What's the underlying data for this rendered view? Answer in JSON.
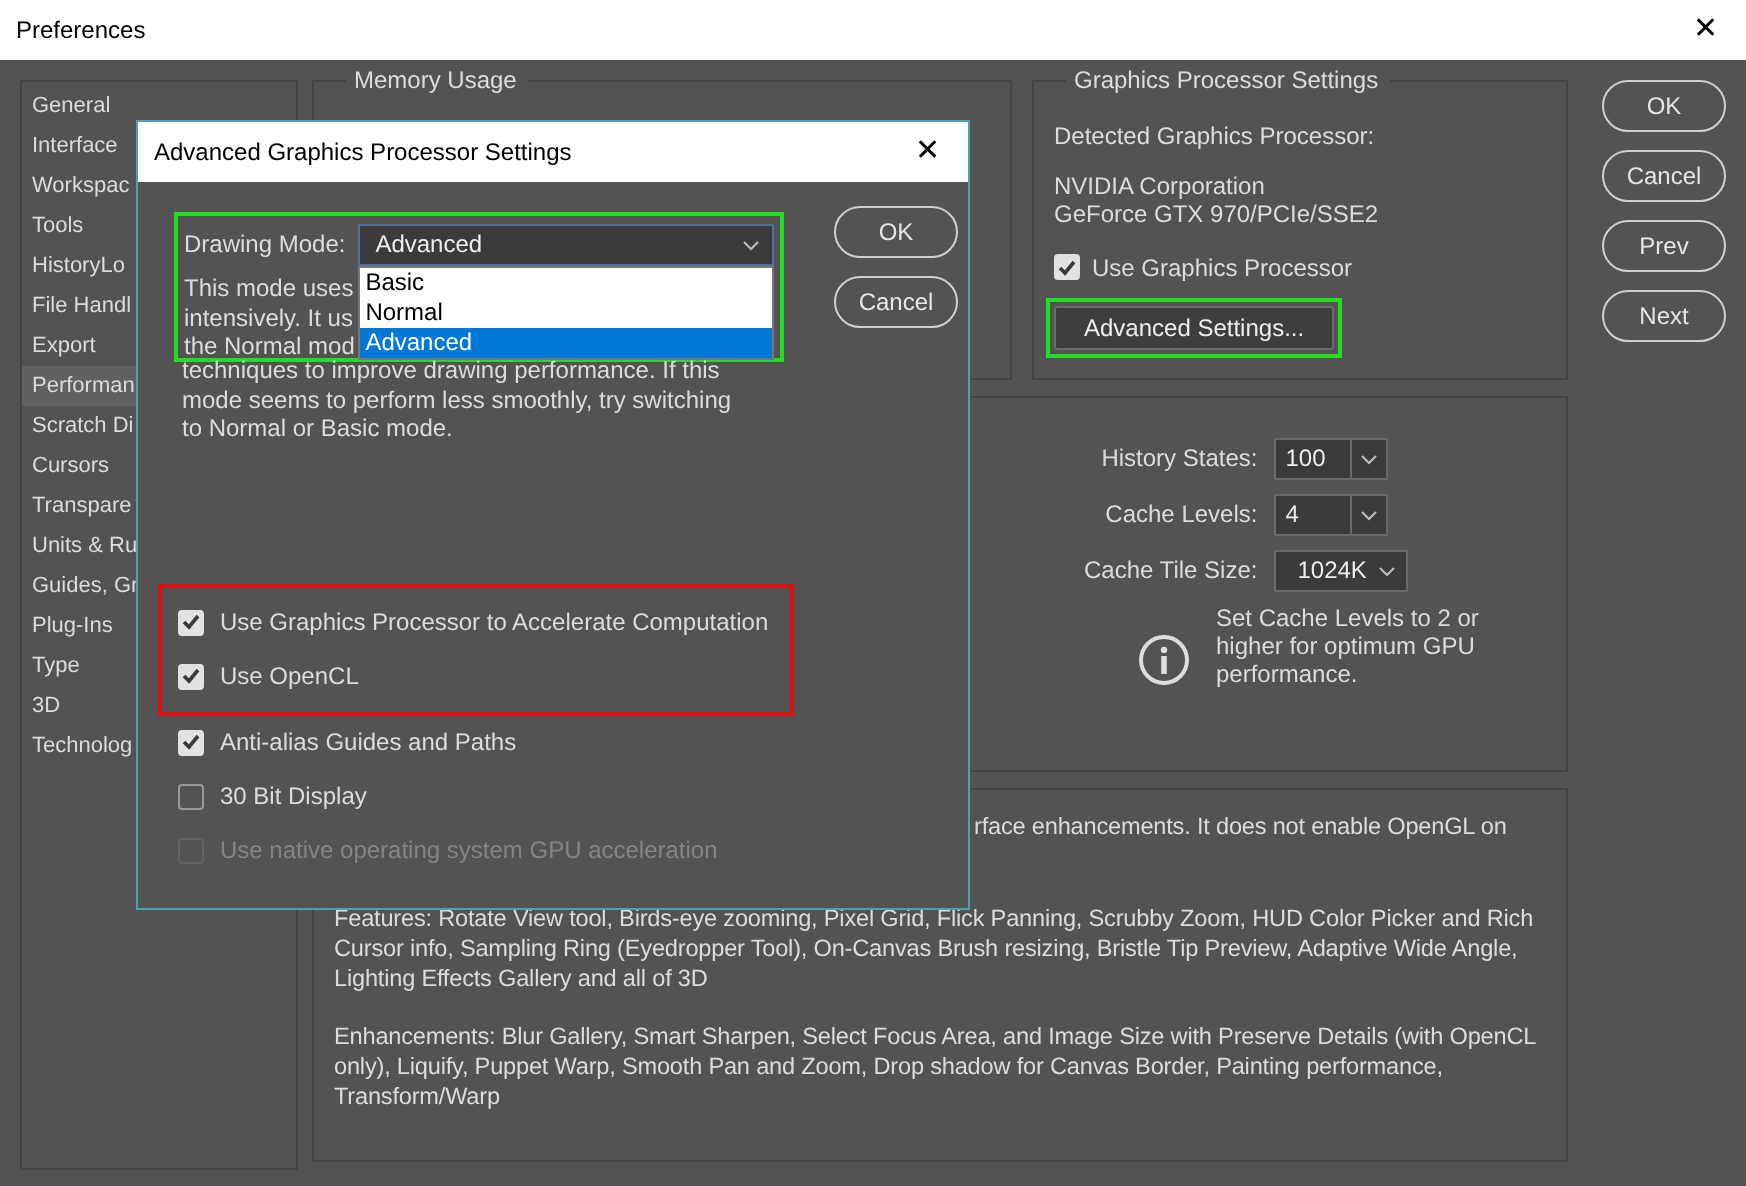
{
  "window": {
    "title": "Preferences",
    "close": "✕"
  },
  "sidebar": {
    "items": [
      {
        "label": "General",
        "selected": false
      },
      {
        "label": "Interface",
        "selected": false
      },
      {
        "label": "Workspac",
        "selected": false
      },
      {
        "label": "Tools",
        "selected": false
      },
      {
        "label": "HistoryLo",
        "selected": false
      },
      {
        "label": "File Handl",
        "selected": false
      },
      {
        "label": "Export",
        "selected": false
      },
      {
        "label": "Performan",
        "selected": true
      },
      {
        "label": "Scratch Di",
        "selected": false
      },
      {
        "label": "Cursors",
        "selected": false
      },
      {
        "label": "Transpare",
        "selected": false
      },
      {
        "label": "Units & Ru",
        "selected": false
      },
      {
        "label": "Guides, Gr",
        "selected": false
      },
      {
        "label": "Plug-Ins",
        "selected": false
      },
      {
        "label": "Type",
        "selected": false
      },
      {
        "label": "3D",
        "selected": false
      },
      {
        "label": "Technolog",
        "selected": false
      }
    ]
  },
  "memory_usage": {
    "title": "Memory Usage"
  },
  "graphics_processor": {
    "title": "Graphics Processor Settings",
    "detected_label": "Detected Graphics Processor:",
    "vendor": "NVIDIA Corporation",
    "model": "GeForce GTX 970/PCIe/SSE2",
    "use_gpu": {
      "label": "Use Graphics Processor",
      "checked": true
    },
    "advanced_button": {
      "label": "Advanced Settings...",
      "color": "#22dd22"
    }
  },
  "history_cache": {
    "fields": [
      {
        "label": "History States:",
        "value": "100"
      },
      {
        "label": "Cache Levels:",
        "value": "4"
      },
      {
        "label": "Cache Tile Size:",
        "value": "1024K"
      }
    ],
    "note": "Set Cache Levels to 2 or higher for optimum GPU performance."
  },
  "description": {
    "paragraphs": [
      "rface enhancements. It does not enable OpenGL on",
      "Features: Rotate View tool, Birds-eye zooming, Pixel Grid, Flick Panning, Scrubby Zoom, HUD Color Picker and Rich Cursor info, Sampling Ring (Eyedropper Tool), On-Canvas Brush resizing, Bristle Tip Preview, Adaptive Wide Angle, Lighting Effects Gallery and all of 3D",
      "Enhancements: Blur Gallery, Smart Sharpen, Select Focus Area, and Image Size with Preserve Details (with OpenCL only), Liquify, Puppet Warp, Smooth Pan and Zoom, Drop shadow for Canvas Border, Painting performance, Transform/Warp"
    ]
  },
  "buttons": [
    "OK",
    "Cancel",
    "Prev",
    "Next"
  ],
  "dialog": {
    "title": "Advanced Graphics Processor Settings",
    "close": "✕",
    "drawing_mode": {
      "label": "Drawing Mode:",
      "value": "Advanced",
      "color": "#22dd22",
      "options": [
        {
          "label": "Basic",
          "selected": false
        },
        {
          "label": "Normal",
          "selected": false
        },
        {
          "label": "Advanced",
          "selected": true
        }
      ]
    },
    "covered_lines": [
      "This mode uses",
      "intensively.  It us",
      "the Normal mod"
    ],
    "description_lines": [
      "techniques to improve drawing performance.  If this",
      "mode seems to perform less smoothly, try switching",
      "to Normal or Basic mode."
    ],
    "buttons": [
      "OK",
      "Cancel"
    ],
    "checkbox_groups": [
      {
        "color": "#dd1111",
        "items": [
          {
            "label": "Use Graphics Processor to Accelerate Computation",
            "checked": true,
            "disabled": false
          },
          {
            "label": "Use OpenCL",
            "checked": true,
            "disabled": false
          }
        ]
      },
      {
        "items": [
          {
            "label": "Anti-alias Guides and Paths",
            "checked": true,
            "disabled": false
          },
          {
            "label": "30 Bit Display",
            "checked": false,
            "disabled": false
          },
          {
            "label": "Use native operating system GPU acceleration",
            "checked": false,
            "disabled": true
          }
        ]
      }
    ]
  }
}
